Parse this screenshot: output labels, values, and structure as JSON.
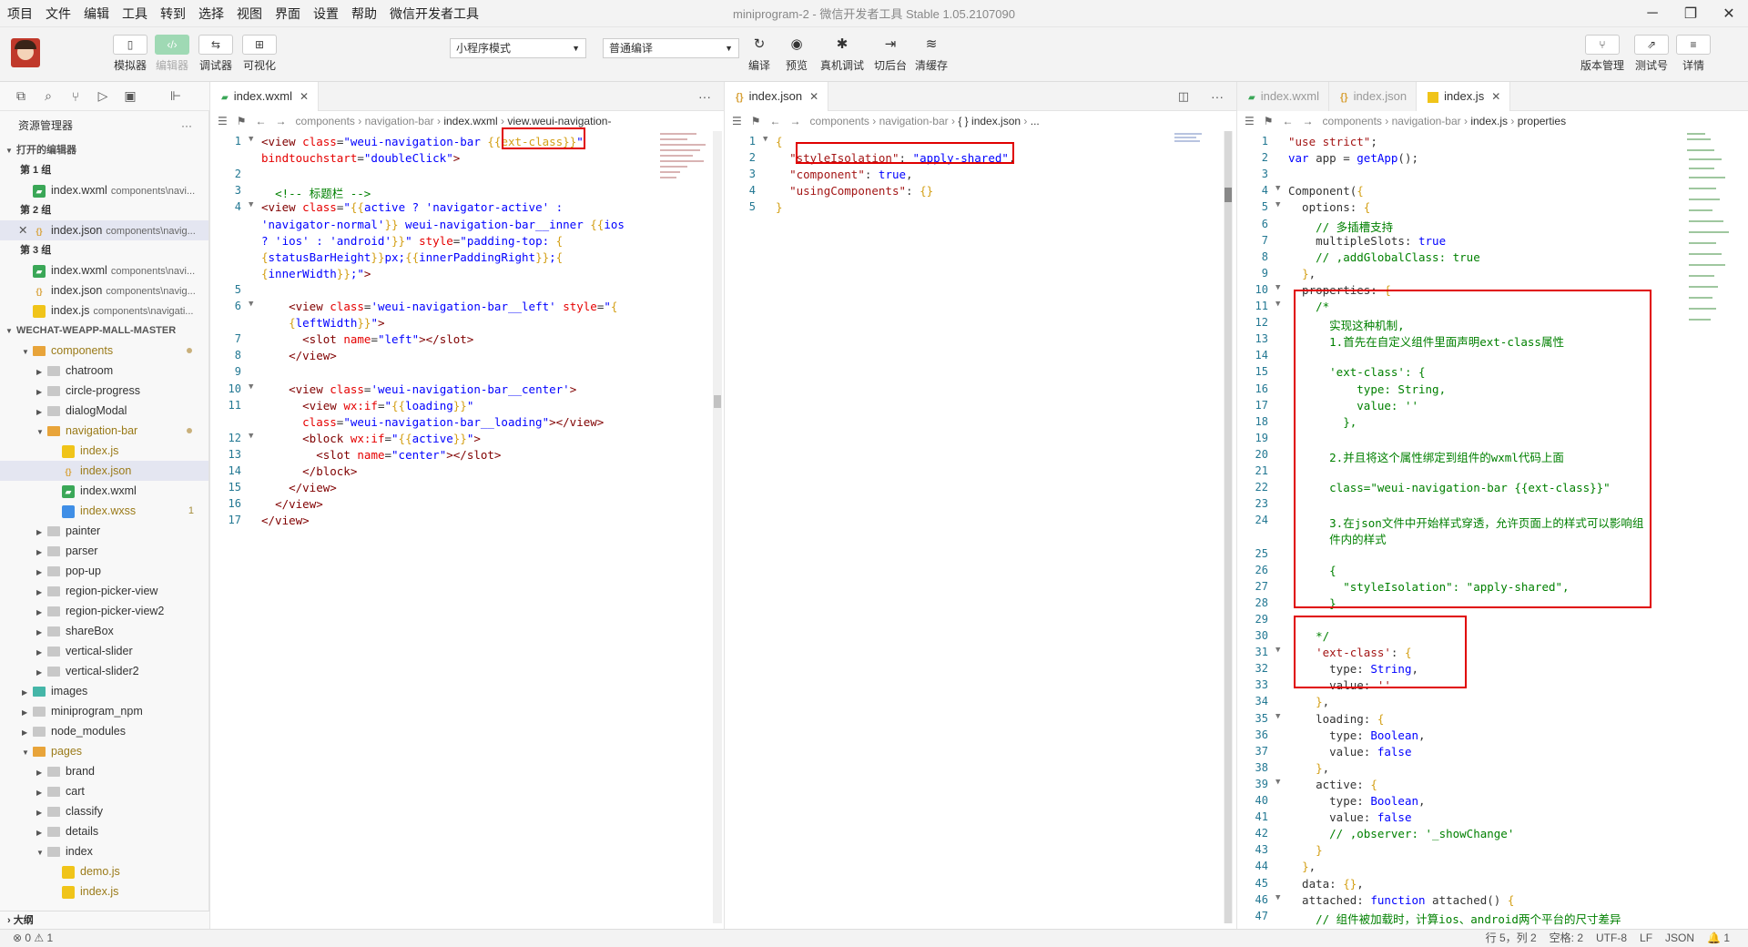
{
  "menu": {
    "items": [
      "项目",
      "文件",
      "编辑",
      "工具",
      "转到",
      "选择",
      "视图",
      "界面",
      "设置",
      "帮助",
      "微信开发者工具"
    ],
    "title": "miniprogram-2 - 微信开发者工具 Stable 1.05.2107090"
  },
  "toolbar": {
    "simulator": "模拟器",
    "editor": "编辑器",
    "debugger": "调试器",
    "visual": "可视化",
    "mode": "小程序模式",
    "compile_mode": "普通编译",
    "compile": "编译",
    "preview": "预览",
    "remote_debug": "真机调试",
    "background": "切后台",
    "clear_cache": "清缓存",
    "version": "版本管理",
    "test": "测试号",
    "details": "详情"
  },
  "explorer": {
    "title": "资源管理器",
    "open_editors": "打开的编辑器",
    "groups": [
      "第 1 组",
      "第 2 组",
      "第 3 组"
    ],
    "open_files": [
      {
        "name": "index.wxml",
        "path": "components\\navi..."
      },
      {
        "name": "index.json",
        "path": "components\\navig..."
      },
      {
        "name": "index.wxml",
        "path": "components\\navi..."
      },
      {
        "name": "index.json",
        "path": "components\\navig..."
      },
      {
        "name": "index.js",
        "path": "components\\navigati..."
      }
    ],
    "project": "WECHAT-WEAPP-MALL-MASTER",
    "tree": [
      "components",
      "chatroom",
      "circle-progress",
      "dialogModal",
      "navigation-bar",
      "index.js",
      "index.json",
      "index.wxml",
      "index.wxss",
      "painter",
      "parser",
      "pop-up",
      "region-picker-view",
      "region-picker-view2",
      "shareBox",
      "vertical-slider",
      "vertical-slider2",
      "images",
      "miniprogram_npm",
      "node_modules",
      "pages",
      "brand",
      "cart",
      "classify",
      "details",
      "index",
      "demo.js",
      "index.js"
    ],
    "badge": "1",
    "outline": "大纲"
  },
  "status": {
    "left": "⊗ 0 ⚠ 1",
    "position": "行 5，列 2",
    "spaces": "空格: 2",
    "encoding": "UTF-8",
    "eol": "LF",
    "lang": "JSON",
    "bell": "🔔 1"
  },
  "pane1": {
    "tab": "index.wxml",
    "crumbs": [
      "components",
      "navigation-bar",
      "index.wxml",
      "view.weui-navigation-"
    ]
  },
  "pane2": {
    "tab": "index.json",
    "crumbs": [
      "components",
      "navigation-bar",
      "{ } index.json",
      "..."
    ]
  },
  "pane3": {
    "tabs": [
      "index.wxml",
      "index.json",
      "index.js"
    ],
    "crumbs": [
      "components",
      "navigation-bar",
      "index.js",
      "properties"
    ]
  },
  "colors": {
    "accent": "#3aa757",
    "highlight": "#e00000"
  }
}
